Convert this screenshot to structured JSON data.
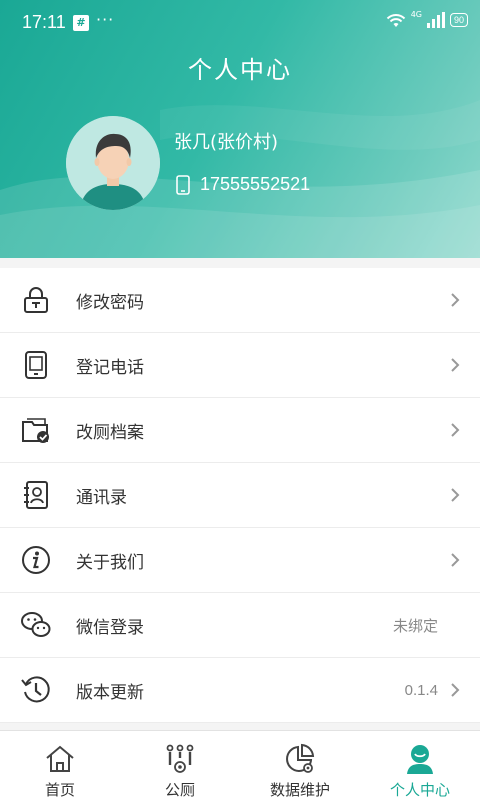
{
  "status_bar": {
    "time": "17:11",
    "notification_badge": "#",
    "more": "···",
    "network": "4G",
    "battery": "90"
  },
  "header": {
    "title": "个人中心"
  },
  "user": {
    "name": "张几(张价村)",
    "phone": "17555552521"
  },
  "menu": [
    {
      "label": "修改密码",
      "icon": "lock-icon",
      "value": ""
    },
    {
      "label": "登记电话",
      "icon": "phone-register-icon",
      "value": ""
    },
    {
      "label": "改厕档案",
      "icon": "archive-folder-icon",
      "value": ""
    },
    {
      "label": "通讯录",
      "icon": "contacts-icon",
      "value": ""
    },
    {
      "label": "关于我们",
      "icon": "info-icon",
      "value": ""
    },
    {
      "label": "微信登录",
      "icon": "wechat-icon",
      "value": "未绑定"
    },
    {
      "label": "版本更新",
      "icon": "history-icon",
      "value": "0.1.4"
    }
  ],
  "tabbar": [
    {
      "label": "首页",
      "icon": "home-icon",
      "active": false
    },
    {
      "label": "公厕",
      "icon": "public-toilet-icon",
      "active": false
    },
    {
      "label": "数据维护",
      "icon": "data-chart-icon",
      "active": false
    },
    {
      "label": "个人中心",
      "icon": "profile-icon",
      "active": true
    }
  ],
  "colors": {
    "accent": "#1aa895",
    "header_light": "#8fd9cd"
  }
}
